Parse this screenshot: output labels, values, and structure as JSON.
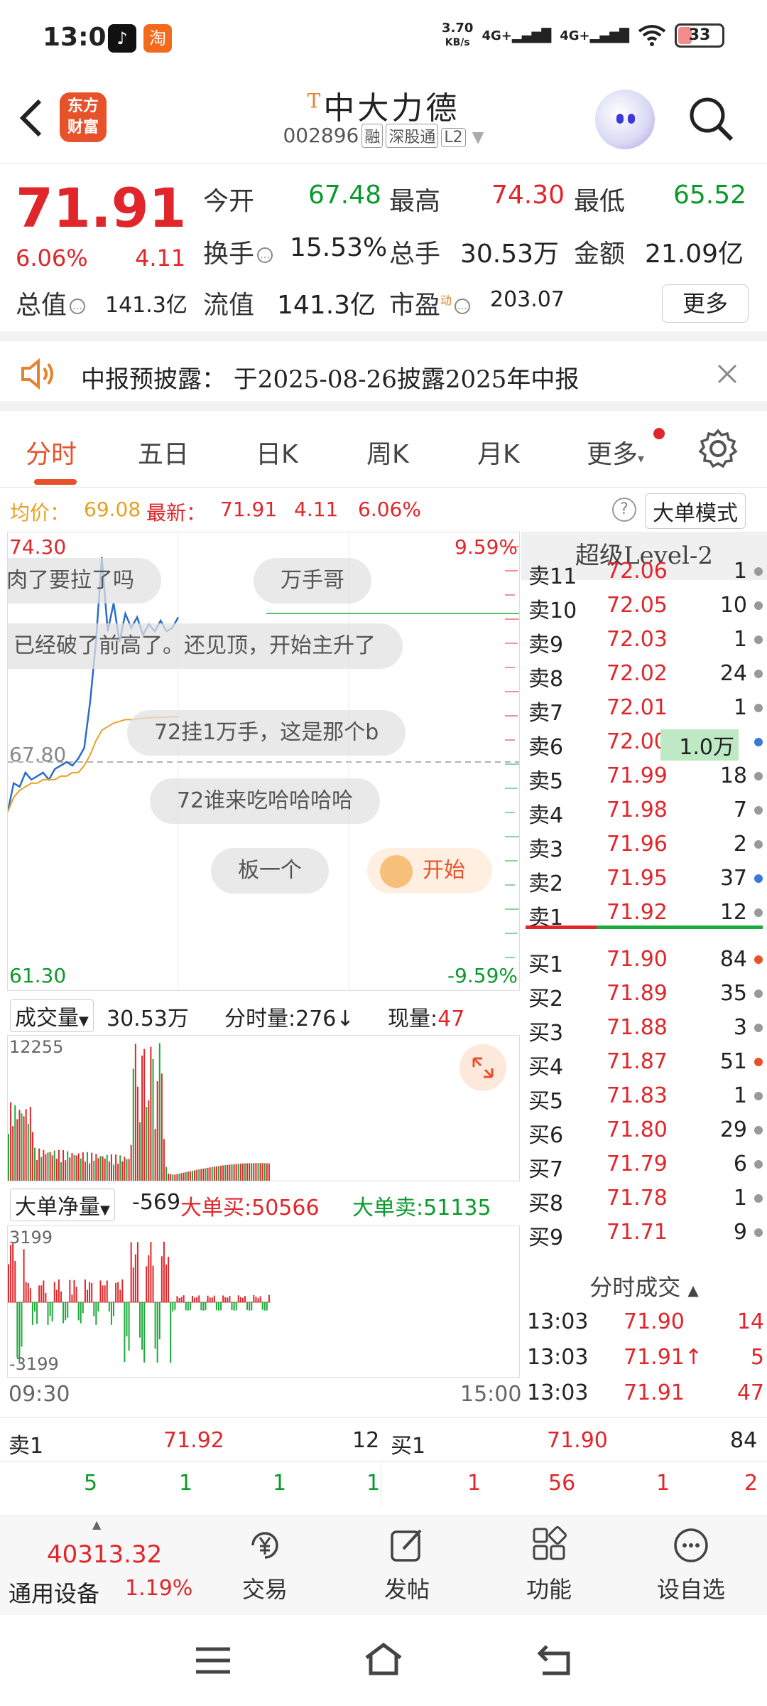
{
  "status_bar": {
    "time": "13:03",
    "net_speed": "3.70",
    "net_unit": "KB/s",
    "sim1": "4G+",
    "sim2": "4G+",
    "battery": "33"
  },
  "header": {
    "logo_text_line1": "东方",
    "logo_text_line2": "财富",
    "t_mark": "T",
    "stock_name": "中大力德",
    "stock_code": "002896",
    "tags": [
      "融",
      "深股通",
      "L2"
    ]
  },
  "quote": {
    "price": "71.91",
    "change_pct": "6.06%",
    "change": "4.11",
    "fields": [
      {
        "label": "今开",
        "value": "67.48",
        "color": "#0a9a2c"
      },
      {
        "label": "最高",
        "value": "74.30",
        "color": "#e0262a"
      },
      {
        "label": "最低",
        "value": "65.52",
        "color": "#0a9a2c"
      },
      {
        "label": "换手",
        "value": "15.53%",
        "color": "#222222"
      },
      {
        "label": "总手",
        "value": "30.53万",
        "color": "#222222"
      },
      {
        "label": "金额",
        "value": "21.09亿",
        "color": "#222222"
      },
      {
        "label": "总值",
        "value": "141.3亿",
        "color": "#222222"
      },
      {
        "label": "流值",
        "value": "141.3亿",
        "color": "#222222"
      },
      {
        "label": "市盈",
        "value": "203.07",
        "color": "#222222"
      }
    ],
    "pe_sup": "动",
    "more_label": "更多"
  },
  "notice": {
    "text": "中报预披露： 于2025-08-26披露2025年中报"
  },
  "tabs": [
    "分时",
    "五日",
    "日K",
    "周K",
    "月K",
    "更多"
  ],
  "avg_line": {
    "avg_label": "均价：",
    "avg_value": "69.08",
    "last_label": "最新：",
    "last_value": "71.91",
    "change": "4.11",
    "change_pct": "6.06%",
    "mode_button": "大单模式"
  },
  "chart": {
    "high_price": "74.30",
    "high_pct": "9.59%",
    "low_price": "61.30",
    "low_pct": "-9.59%",
    "ref_price": "67.80",
    "danmu": [
      "肉了要拉了吗",
      "万手哥",
      "，已经破了前高了。还见顶，开始主升了",
      "72挂1万手，这是那个b",
      "72谁来吃哈哈哈哈",
      "板一个",
      "开始"
    ]
  },
  "chart_data": {
    "type": "line",
    "ylim": [
      61.3,
      74.3
    ],
    "reference": 67.8,
    "series": [
      {
        "values": [
          66.4,
          67.2,
          67.1,
          67.5,
          67.3,
          67.4,
          67.5,
          67.3,
          67.6,
          67.7,
          67.8,
          67.7,
          67.9,
          68.2,
          69.5,
          71.2,
          73.6,
          71.5,
          72.3,
          71.2,
          72.0,
          71.6,
          71.9,
          71.4,
          71.7,
          71.5,
          71.8,
          71.5,
          71.6,
          71.9
        ]
      },
      {
        "values": [
          66.4,
          66.8,
          67.0,
          67.1,
          67.2,
          67.2,
          67.3,
          67.3,
          67.3,
          67.4,
          67.4,
          67.5,
          67.5,
          67.7,
          68.0,
          68.4,
          68.7,
          68.8,
          68.9,
          68.95,
          69.0,
          69.0,
          69.02,
          69.04,
          69.05,
          69.06,
          69.07,
          69.07,
          69.08,
          69.08
        ]
      }
    ]
  },
  "volume": {
    "label": "成交量",
    "total": "30.53万",
    "tick_label": "分时量:276",
    "now_label": "现量:",
    "now_value": "47",
    "max": "12255"
  },
  "flow": {
    "label": "大单净量",
    "value": "-569",
    "buy_label": "大单买:",
    "buy_value": "50566",
    "sell_label": "大单卖:",
    "sell_value": "51135",
    "max": "3199",
    "min": "-3199",
    "time_start": "09:30",
    "time_end": "15:00"
  },
  "order_book": {
    "title": "超级Level-2",
    "asks": [
      {
        "label": "卖11",
        "price": "72.06",
        "vol": "1"
      },
      {
        "label": "卖10",
        "price": "72.05",
        "vol": "10"
      },
      {
        "label": "卖9",
        "price": "72.03",
        "vol": "1"
      },
      {
        "label": "卖8",
        "price": "72.02",
        "vol": "24"
      },
      {
        "label": "卖7",
        "price": "72.01",
        "vol": "1"
      },
      {
        "label": "卖6",
        "price": "72.00",
        "vol": "1.0万"
      },
      {
        "label": "卖5",
        "price": "71.99",
        "vol": "18"
      },
      {
        "label": "卖4",
        "price": "71.98",
        "vol": "7"
      },
      {
        "label": "卖3",
        "price": "71.96",
        "vol": "2"
      },
      {
        "label": "卖2",
        "price": "71.95",
        "vol": "37"
      },
      {
        "label": "卖1",
        "price": "71.92",
        "vol": "12"
      }
    ],
    "bids": [
      {
        "label": "买1",
        "price": "71.90",
        "vol": "84"
      },
      {
        "label": "买2",
        "price": "71.89",
        "vol": "35"
      },
      {
        "label": "买3",
        "price": "71.88",
        "vol": "3"
      },
      {
        "label": "买4",
        "price": "71.87",
        "vol": "51"
      },
      {
        "label": "买5",
        "price": "71.83",
        "vol": "1"
      },
      {
        "label": "买6",
        "price": "71.80",
        "vol": "29"
      },
      {
        "label": "买7",
        "price": "71.79",
        "vol": "6"
      },
      {
        "label": "买8",
        "price": "71.78",
        "vol": "1"
      },
      {
        "label": "买9",
        "price": "71.71",
        "vol": "9"
      }
    ],
    "trades_title": "分时成交",
    "trades": [
      {
        "time": "13:03",
        "price": "71.90",
        "vol": "14"
      },
      {
        "time": "13:03",
        "price": "71.91↑",
        "vol": "5"
      },
      {
        "time": "13:03",
        "price": "71.91",
        "vol": "47"
      }
    ]
  },
  "summary": {
    "sell_label": "卖1",
    "sell_price": "71.92",
    "sell_vol": "12",
    "buy_label": "买1",
    "buy_price": "71.90",
    "buy_vol": "84",
    "sell_counts": [
      "5",
      "1",
      "1",
      "1"
    ],
    "buy_counts": [
      "1",
      "56",
      "1",
      "2"
    ]
  },
  "nav": {
    "index_value": "40313.32",
    "index_name": "通用设备",
    "index_pct": "1.19%",
    "items": [
      "交易",
      "发帖",
      "功能",
      "设自选"
    ]
  }
}
